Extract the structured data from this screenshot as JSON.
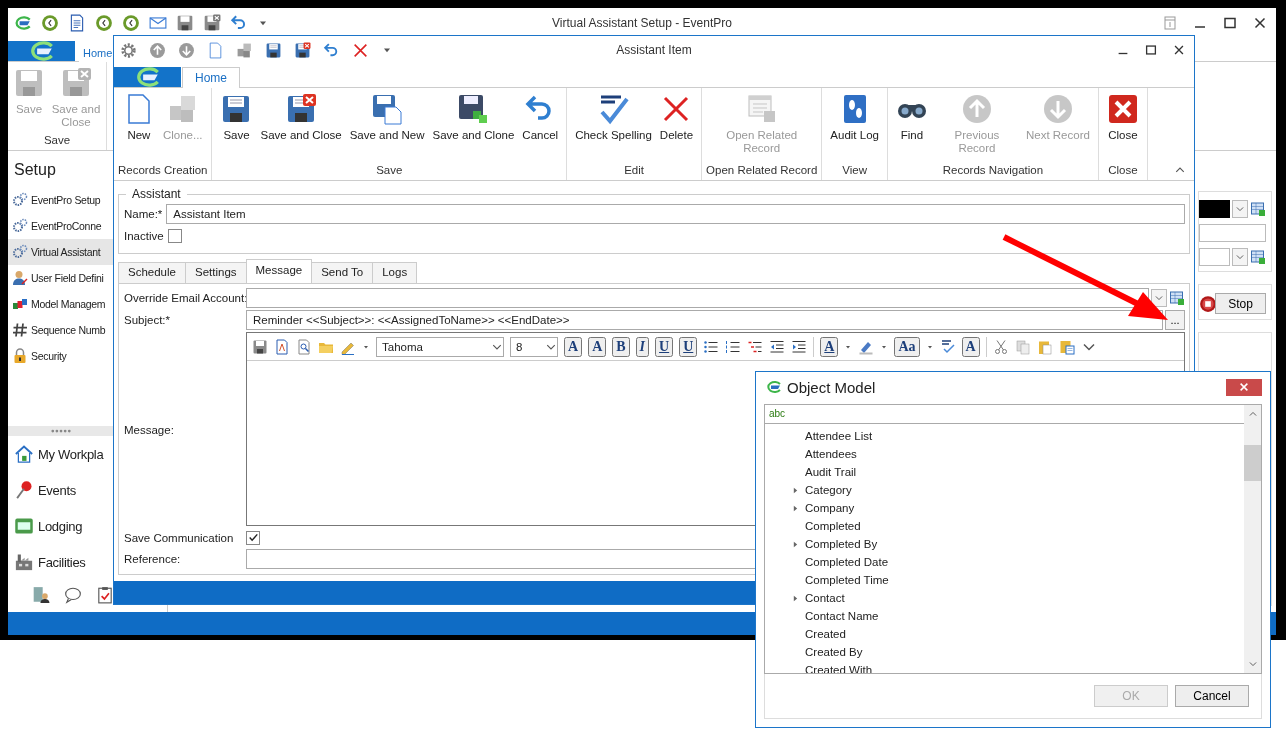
{
  "main_window": {
    "title": "Virtual Assistant Setup - EventPro",
    "ribbon_tab": "Home",
    "ribbon_buttons": [
      {
        "label": "Save",
        "kind": "save",
        "disabled": true
      },
      {
        "label": "Save and Close",
        "kind": "save-close",
        "disabled": true
      }
    ],
    "ribbon_group": "Save",
    "nav_header": "Setup",
    "nav_items": [
      {
        "label": "EventPro Setup",
        "kind": "gears",
        "selected": false
      },
      {
        "label": "EventProConne",
        "kind": "gears",
        "selected": false
      },
      {
        "label": "Virtual Assistant",
        "kind": "gears",
        "selected": true
      },
      {
        "label": "User Field Defini",
        "kind": "user",
        "selected": false
      },
      {
        "label": "Model Managem",
        "kind": "models",
        "selected": false
      },
      {
        "label": "Sequence Numb",
        "kind": "hash",
        "selected": false
      },
      {
        "label": "Security",
        "kind": "lock",
        "selected": false
      }
    ],
    "modules": [
      {
        "label": "My Workpla",
        "kind": "house"
      },
      {
        "label": "Events",
        "kind": "pin"
      },
      {
        "label": "Lodging",
        "kind": "bed"
      },
      {
        "label": "Facilities",
        "kind": "factory"
      }
    ],
    "stop_button": "Stop"
  },
  "assistant_window": {
    "title": "Assistant Item",
    "ribbon_tab": "Home",
    "ribbon_groups": [
      {
        "label": "Records Creation",
        "buttons": [
          {
            "label": "New",
            "kind": "new",
            "disabled": false
          },
          {
            "label": "Clone...",
            "kind": "clone",
            "disabled": true
          }
        ]
      },
      {
        "label": "Save",
        "buttons": [
          {
            "label": "Save",
            "kind": "save",
            "disabled": false
          },
          {
            "label": "Save and Close",
            "kind": "save-close",
            "disabled": false
          },
          {
            "label": "Save and New",
            "kind": "save-new",
            "disabled": false
          },
          {
            "label": "Save and Clone",
            "kind": "save-clone",
            "disabled": false
          },
          {
            "label": "Cancel",
            "kind": "undo",
            "disabled": false
          }
        ]
      },
      {
        "label": "Edit",
        "buttons": [
          {
            "label": "Check Spelling",
            "kind": "spell",
            "disabled": false
          },
          {
            "label": "Delete",
            "kind": "delete",
            "disabled": false
          }
        ]
      },
      {
        "label": "Open Related Record",
        "buttons": [
          {
            "label": "Open Related Record",
            "kind": "related",
            "disabled": true
          }
        ]
      },
      {
        "label": "View",
        "buttons": [
          {
            "label": "Audit Log",
            "kind": "audit",
            "disabled": false
          }
        ]
      },
      {
        "label": "Records Navigation",
        "buttons": [
          {
            "label": "Find",
            "kind": "find",
            "disabled": false
          },
          {
            "label": "Previous Record",
            "kind": "up",
            "disabled": true
          },
          {
            "label": "Next Record",
            "kind": "down",
            "disabled": true
          }
        ]
      },
      {
        "label": "Close",
        "buttons": [
          {
            "label": "Close",
            "kind": "close",
            "disabled": false
          }
        ]
      }
    ],
    "group_title": "Assistant",
    "name_label": "Name:*",
    "name_value": "Assistant Item",
    "inactive_label": "Inactive",
    "inactive_checked": false,
    "tabs": [
      {
        "label": "Schedule",
        "selected": false
      },
      {
        "label": "Settings",
        "selected": false
      },
      {
        "label": "Message",
        "selected": true
      },
      {
        "label": "Send To",
        "selected": false
      },
      {
        "label": "Logs",
        "selected": false
      }
    ],
    "override_label": "Override Email Account:",
    "subject_label": "Subject:*",
    "subject_value": "Reminder <<Subject>>: <<AssignedToName>> <<EndDate>>",
    "subject_button": "...",
    "message_label": "Message:",
    "editor_font": "Tahoma",
    "editor_size": "8",
    "editor_glyphs": [
      "A",
      "A",
      "B",
      "I",
      "U",
      "U",
      "A",
      "Aa",
      "A"
    ],
    "save_comm_label": "Save Communication",
    "save_comm_checked": true,
    "reference_label": "Reference:"
  },
  "object_model_dialog": {
    "title": "Object Model",
    "filter_marker": "abc",
    "items": [
      {
        "label": "Attendee List",
        "expandable": false
      },
      {
        "label": "Attendees",
        "expandable": false
      },
      {
        "label": "Audit Trail",
        "expandable": false
      },
      {
        "label": "Category",
        "expandable": true
      },
      {
        "label": "Company",
        "expandable": true
      },
      {
        "label": "Completed",
        "expandable": false
      },
      {
        "label": "Completed By",
        "expandable": true
      },
      {
        "label": "Completed Date",
        "expandable": false
      },
      {
        "label": "Completed Time",
        "expandable": false
      },
      {
        "label": "Contact",
        "expandable": true
      },
      {
        "label": "Contact Name",
        "expandable": false
      },
      {
        "label": "Created",
        "expandable": false
      },
      {
        "label": "Created By",
        "expandable": false
      },
      {
        "label": "Created With",
        "expandable": false
      }
    ],
    "buttons": [
      {
        "label": "OK",
        "disabled": true
      },
      {
        "label": "Cancel",
        "disabled": false
      }
    ]
  }
}
